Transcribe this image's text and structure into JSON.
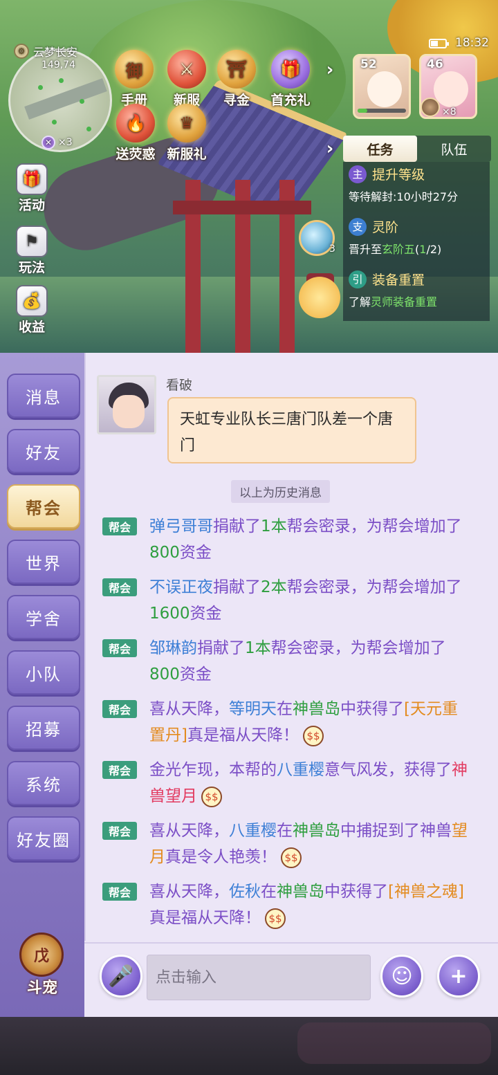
{
  "status": {
    "time": "18:32",
    "battery_level": 0.45
  },
  "minimap": {
    "location": "云梦长安",
    "coords": "149,74",
    "multiplier": "×3"
  },
  "top_icons": [
    {
      "label": "手册",
      "icon": "book-icon"
    },
    {
      "label": "新服",
      "icon": "sword-icon"
    },
    {
      "label": "寻金",
      "icon": "pagoda-icon"
    },
    {
      "label": "首充礼",
      "icon": "gift-icon"
    },
    {
      "label": "送荧惑",
      "icon": "flame-icon"
    },
    {
      "label": "新服礼",
      "icon": "crown-icon"
    }
  ],
  "side_icons": [
    {
      "label": "活动",
      "icon": "gift-box-icon"
    },
    {
      "label": "玩法",
      "icon": "flag-icon"
    },
    {
      "label": "收益",
      "icon": "money-bag-icon"
    }
  ],
  "cards": {
    "pet": {
      "level": "52",
      "hp_fraction": 0.2
    },
    "hero": {
      "level": "46",
      "count": "×8"
    }
  },
  "task_panel": {
    "tabs": [
      {
        "label": "任务",
        "active": true
      },
      {
        "label": "队伍",
        "active": false
      }
    ],
    "tasks": [
      {
        "badge": "主",
        "title": "提升等级",
        "desc_parts": [
          "等待解封:10小时27分"
        ]
      },
      {
        "badge": "支",
        "title": "灵阶",
        "desc_parts": [
          "晋升至",
          "玄阶五",
          "(",
          "1",
          "/2)"
        ]
      },
      {
        "badge": "引",
        "title": "装备重置",
        "desc_parts": [
          "了解",
          "灵师装备重置"
        ]
      }
    ],
    "orb_count": "3"
  },
  "chat": {
    "categories": [
      {
        "label": "消息",
        "active": false
      },
      {
        "label": "好友",
        "active": false
      },
      {
        "label": "帮会",
        "active": true
      },
      {
        "label": "世界",
        "active": false
      },
      {
        "label": "学舍",
        "active": false
      },
      {
        "label": "小队",
        "active": false
      },
      {
        "label": "招募",
        "active": false
      },
      {
        "label": "系统",
        "active": false
      },
      {
        "label": "好友圈",
        "active": false
      }
    ],
    "doupet_label": "斗宠",
    "doupet_badge": "戊",
    "sender": {
      "name": "看破",
      "message": "天虹专业队长三唐门队差一个唐门"
    },
    "history_note": "以上为历史消息",
    "tag": "帮会",
    "messages": [
      {
        "parts": [
          [
            "弹弓哥哥",
            "blue"
          ],
          [
            "捐献了",
            ""
          ],
          [
            "1本",
            "green"
          ],
          [
            "帮会密录，为帮会增加了",
            ""
          ],
          [
            "800",
            "green"
          ],
          [
            "资金",
            ""
          ]
        ]
      },
      {
        "parts": [
          [
            "不误正夜",
            "blue"
          ],
          [
            "捐献了",
            ""
          ],
          [
            "2本",
            "green"
          ],
          [
            "帮会密录，为帮会增加了",
            ""
          ],
          [
            "1600",
            "green"
          ],
          [
            "资金",
            ""
          ]
        ]
      },
      {
        "parts": [
          [
            "邹琳韵",
            "blue"
          ],
          [
            "捐献了",
            ""
          ],
          [
            "1本",
            "green"
          ],
          [
            "帮会密录，为帮会增加了",
            ""
          ],
          [
            "800",
            "green"
          ],
          [
            "资金",
            ""
          ]
        ]
      },
      {
        "parts": [
          [
            "喜从天降，",
            ""
          ],
          [
            "等明天",
            "blue"
          ],
          [
            "在",
            ""
          ],
          [
            "神兽岛",
            "green"
          ],
          [
            "中获得了",
            ""
          ],
          [
            "[天元重置丹]",
            "orange"
          ],
          [
            "真是福从天降！",
            ""
          ]
        ],
        "emoji": true
      },
      {
        "parts": [
          [
            "金光乍现，本帮的",
            ""
          ],
          [
            "八重樱",
            "blue"
          ],
          [
            "意气风发，获得了",
            ""
          ],
          [
            "神兽望月",
            "red"
          ]
        ],
        "emoji": true
      },
      {
        "parts": [
          [
            "喜从天降，",
            ""
          ],
          [
            "八重樱",
            "blue"
          ],
          [
            "在",
            ""
          ],
          [
            "神兽岛",
            "green"
          ],
          [
            "中捕捉到了神兽",
            ""
          ],
          [
            "望月",
            "orange"
          ],
          [
            "真是令人艳羡！",
            ""
          ]
        ],
        "emoji": true
      },
      {
        "parts": [
          [
            "喜从天降，",
            ""
          ],
          [
            "佐秋",
            "blue"
          ],
          [
            "在",
            ""
          ],
          [
            "神兽岛",
            "green"
          ],
          [
            "中获得了",
            ""
          ],
          [
            "[神兽之魂]",
            "orange"
          ],
          [
            "真是福从天降！",
            ""
          ]
        ],
        "emoji": true
      }
    ],
    "input_placeholder": "点击输入"
  },
  "colors": {
    "guild_tag": "#3b9d7c",
    "name_blue": "#3d7fd6",
    "value_green": "#2e9e3f",
    "item_orange": "#e38b1f",
    "text_purple": "#7b4ec6"
  }
}
